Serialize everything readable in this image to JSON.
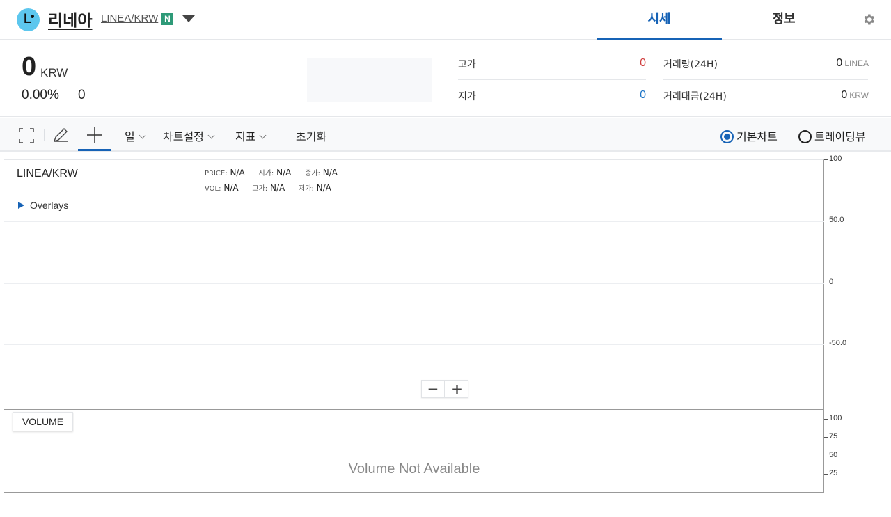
{
  "header": {
    "coin_name": "리네아",
    "pair": "LINEA/KRW",
    "badge": "N",
    "tabs": [
      {
        "label": "시세",
        "active": true
      },
      {
        "label": "정보",
        "active": false
      }
    ],
    "accent_color": "#1763b6"
  },
  "summary": {
    "price": "0",
    "price_unit": "KRW",
    "change_rate": "0.00%",
    "change_price": "0",
    "high_label": "고가",
    "high_value": "0",
    "low_label": "저가",
    "low_value": "0",
    "volume_label": "거래량(24H)",
    "volume_value": "0",
    "volume_unit": "LINEA",
    "amount_label": "거래대금(24H)",
    "amount_value": "0",
    "amount_unit": "KRW",
    "high_color": "#d03c3c",
    "low_color": "#1a73c7"
  },
  "toolbar": {
    "interval_label": "일",
    "chart_settings_label": "차트설정",
    "indicators_label": "지표",
    "reset_label": "초기화",
    "basic_chart_label": "기본차트",
    "tradingview_label": "트레이딩뷰",
    "selected_chart": "basic"
  },
  "chart": {
    "pair": "LINEA/KRW",
    "info_row1": [
      {
        "key": "PRICE:",
        "value": "N/A"
      },
      {
        "key": "시가:",
        "value": "N/A"
      },
      {
        "key": "종가:",
        "value": "N/A"
      }
    ],
    "info_row2": [
      {
        "key": "VOL:",
        "value": "N/A"
      },
      {
        "key": "고가:",
        "value": "N/A"
      },
      {
        "key": "저가:",
        "value": "N/A"
      }
    ],
    "overlays_label": "Overlays",
    "price_axis": [
      "100",
      "50.0",
      "0",
      "-50.0"
    ],
    "zoom_out": "−",
    "zoom_in": "+"
  },
  "volume": {
    "button_label": "VOLUME",
    "empty_text": "Volume Not Available",
    "axis": [
      "100",
      "75",
      "50",
      "25"
    ]
  }
}
